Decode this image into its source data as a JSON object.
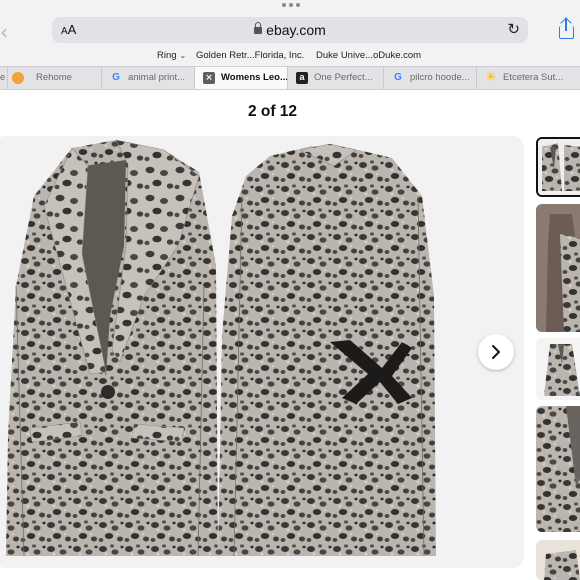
{
  "browser": {
    "address": {
      "text_size_label_small": "A",
      "text_size_label_large": "A",
      "url": "ebay.com"
    },
    "favorites": [
      {
        "label": "Ring",
        "has_menu": true
      },
      {
        "label": "Golden Retr...Florida, Inc."
      },
      {
        "label": "Duke Unive...oDuke.com"
      }
    ],
    "tabs": [
      {
        "label": "e",
        "icon": "none"
      },
      {
        "label": "Rehome",
        "icon": "paw-icon"
      },
      {
        "label": "animal print...",
        "icon": "google-icon"
      },
      {
        "label": "Womens Leo...",
        "icon": "close-icon",
        "active": true
      },
      {
        "label": "One Perfect...",
        "icon": "amazon-icon"
      },
      {
        "label": "pilcro hoode...",
        "icon": "google-icon"
      },
      {
        "label": "Etcetera Sut...",
        "icon": "walmart-icon"
      }
    ]
  },
  "gallery": {
    "counter": "2 of 12",
    "next_icon": "chevron-right-icon",
    "thumbnail_count_visible": 6,
    "selected_thumbnail": 1
  },
  "colors": {
    "accent": "#2a7de1",
    "blazer_base": "#b9b4ae",
    "blazer_spot": "#3b3735",
    "lining": "#5e5852"
  }
}
